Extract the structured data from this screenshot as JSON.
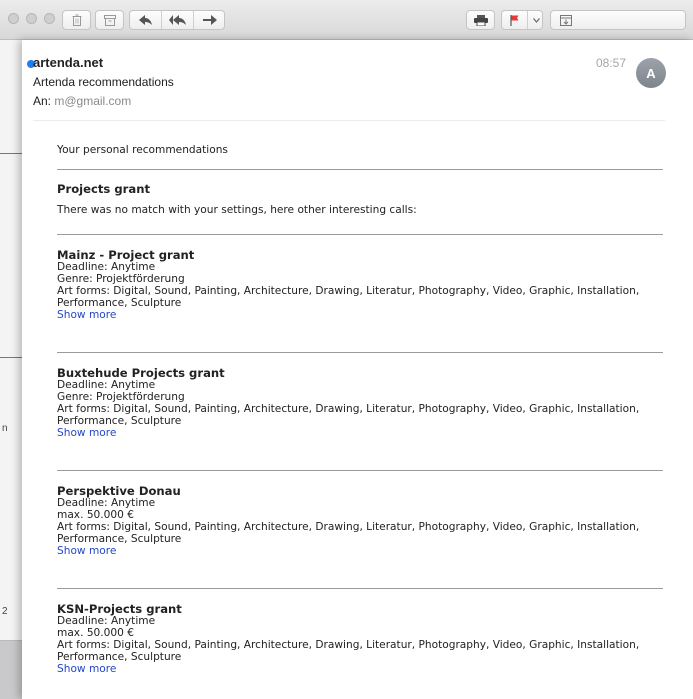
{
  "background": {
    "chars": [
      "n",
      "2"
    ]
  },
  "toolbar": {
    "icons": [
      "trash-icon",
      "archive-icon",
      "reply-icon",
      "reply-all-icon",
      "forward-icon",
      "print-icon",
      "flag-icon",
      "chevron-down-icon",
      "move-icon"
    ]
  },
  "message": {
    "sender": "artenda.net",
    "subject": "Artenda recommendations",
    "to_label": "An:",
    "to_value": "m@gmail.com",
    "time": "08:57",
    "avatar_initial": "A",
    "unread_color": "#1f7cf2"
  },
  "content": {
    "intro": "Your personal recommendations",
    "section_title": "Projects grant",
    "section_note": "There was no match with your settings, here other interesting calls:",
    "items": [
      {
        "title": "Mainz - Project grant",
        "lines": [
          "Deadline: Anytime",
          "Genre: Projektförderung",
          "Art forms: Digital, Sound, Painting, Architecture, Drawing, Literatur, Photography, Video, Graphic, Installation,",
          "Performance, Sculpture"
        ],
        "show_more": "Show more"
      },
      {
        "title": "Buxtehude Projects grant",
        "lines": [
          "Deadline: Anytime",
          "Genre: Projektförderung",
          "Art forms: Digital, Sound, Painting, Architecture, Drawing, Literatur, Photography, Video, Graphic, Installation,",
          "Performance, Sculpture"
        ],
        "show_more": "Show more"
      },
      {
        "title": "Perspektive Donau",
        "lines": [
          "Deadline: Anytime",
          "max. 50.000 €",
          "Art forms: Digital, Sound, Painting, Architecture, Drawing, Literatur, Photography, Video, Graphic, Installation,",
          "Performance, Sculpture"
        ],
        "show_more": "Show more"
      },
      {
        "title": "KSN-Projects grant",
        "lines": [
          "Deadline: Anytime",
          "max. 50.000 €",
          "Art forms: Digital, Sound, Painting, Architecture, Drawing, Literatur, Photography, Video, Graphic, Installation,",
          "Performance, Sculpture"
        ],
        "show_more": "Show more"
      }
    ]
  }
}
